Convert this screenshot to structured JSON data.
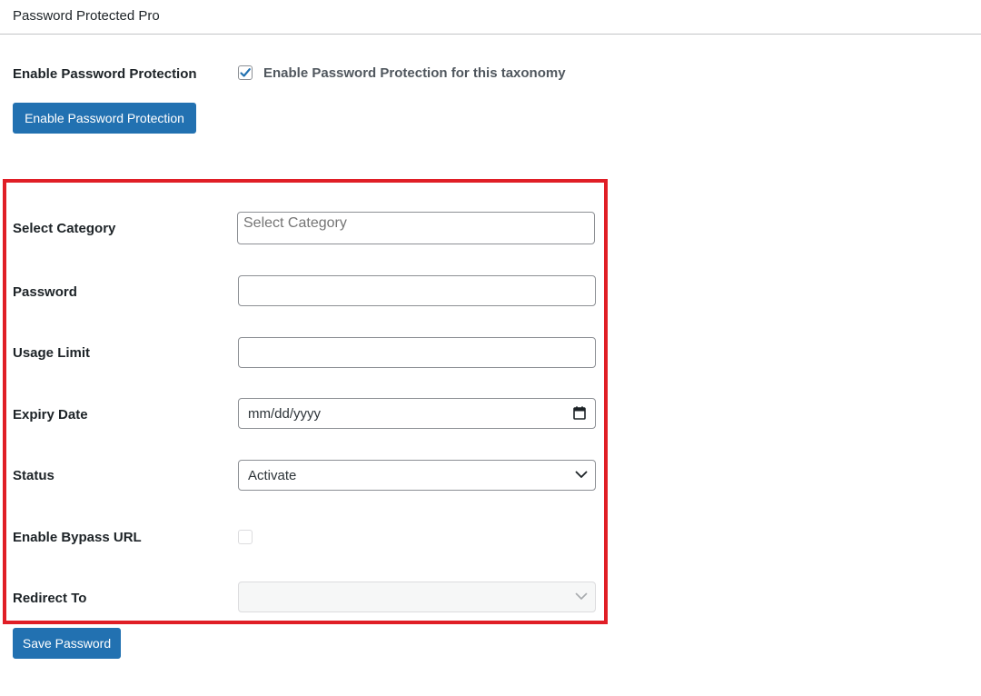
{
  "panel": {
    "title": "Password Protected Pro"
  },
  "enable": {
    "label": "Enable Password Protection",
    "checkbox_checked": true,
    "checkbox_text": "Enable Password Protection for this taxonomy",
    "button_label": "Enable Password Protection"
  },
  "form": {
    "category": {
      "label": "Select Category",
      "placeholder": "Select Category"
    },
    "password": {
      "label": "Password",
      "value": ""
    },
    "usage_limit": {
      "label": "Usage Limit",
      "value": ""
    },
    "expiry": {
      "label": "Expiry Date",
      "value": "mm/dd/yyyy"
    },
    "status": {
      "label": "Status",
      "value": "Activate"
    },
    "bypass": {
      "label": "Enable Bypass URL",
      "checked": false
    },
    "redirect": {
      "label": "Redirect To",
      "value": ""
    }
  },
  "save_button": {
    "label": "Save Password"
  },
  "colors": {
    "primary": "#2271b1",
    "highlight_border": "#e01e26"
  },
  "icons": {
    "checkbox": "checkmark-icon",
    "date": "calendar-icon",
    "select": "chevron-down-icon"
  }
}
